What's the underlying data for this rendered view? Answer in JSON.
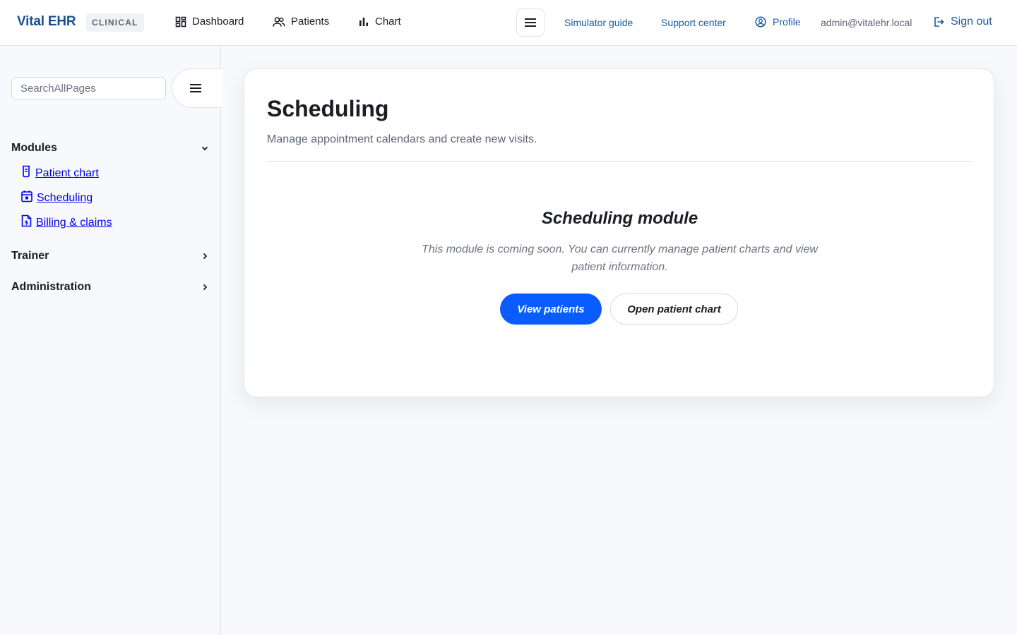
{
  "header": {
    "brand": "Vital EHR",
    "badge": "CLINICAL",
    "nav": [
      {
        "label": "Dashboard",
        "icon": "dashboard-icon"
      },
      {
        "label": "Patients",
        "icon": "users-icon"
      },
      {
        "label": "Chart",
        "icon": "bar-chart-icon"
      }
    ],
    "links": {
      "simulator_guide": "Simulator guide",
      "support_center": "Support center",
      "profile": "Profile",
      "user_email": "admin@vitalehr.local",
      "sign_out": "Sign out"
    }
  },
  "sidebar": {
    "search_placeholder": "SearchAllPages",
    "sections": [
      {
        "label": "Modules",
        "expanded": true,
        "items": [
          {
            "label": " Patient chart",
            "icon": "clipboard-icon"
          },
          {
            "label": " Scheduling",
            "icon": "calendar-icon"
          },
          {
            "label": " Billing & claims",
            "icon": "invoice-icon"
          }
        ]
      },
      {
        "label": "Trainer",
        "expanded": false
      },
      {
        "label": "Administration",
        "expanded": false
      }
    ]
  },
  "main": {
    "title": "Scheduling",
    "subtitle": "Manage appointment calendars and create new visits.",
    "module_title": "Scheduling module",
    "module_description": "This module is coming soon. You can currently manage patient charts and view patient information.",
    "primary_button": "View patients",
    "secondary_button": "Open patient chart"
  },
  "colors": {
    "brand": "#1b4f8f",
    "link": "#1b5a9e",
    "primary": "#0a5cff",
    "sidebar_link": "#0000ee"
  }
}
